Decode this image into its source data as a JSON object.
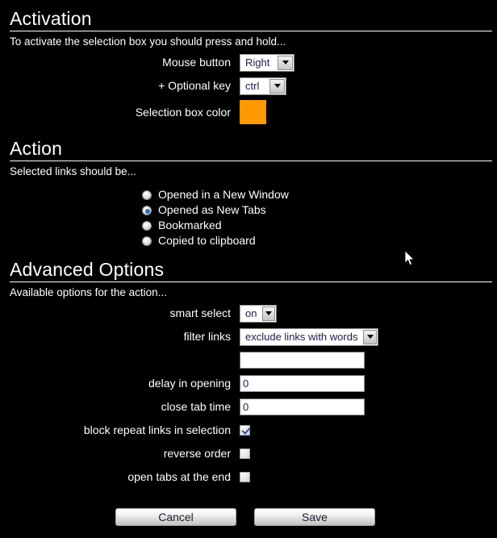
{
  "sections": {
    "activation": {
      "title": "Activation",
      "subtitle": "To activate the selection box you should press and hold...",
      "fields": {
        "mouse_button": {
          "label": "Mouse button",
          "value": "Right"
        },
        "optional_key": {
          "label": "+ Optional key",
          "value": "ctrl"
        },
        "selection_color": {
          "label": "Selection box color",
          "value": "#FF9900"
        }
      }
    },
    "action": {
      "title": "Action",
      "subtitle": "Selected links should be...",
      "options": [
        {
          "label": "Opened in a New Window",
          "selected": false
        },
        {
          "label": "Opened as New Tabs",
          "selected": true
        },
        {
          "label": "Bookmarked",
          "selected": false
        },
        {
          "label": "Copied to clipboard",
          "selected": false
        }
      ]
    },
    "advanced": {
      "title": "Advanced Options",
      "subtitle": "Available options for the action...",
      "fields": {
        "smart_select": {
          "label": "smart select",
          "value": "on"
        },
        "filter_links": {
          "label": "filter links",
          "value": "exclude links with words"
        },
        "filter_words": {
          "label": "",
          "value": "",
          "placeholder": ""
        },
        "delay_in_opening": {
          "label": "delay in opening",
          "value": "0"
        },
        "close_tab_time": {
          "label": "close tab time",
          "value": "0"
        },
        "block_repeat_links": {
          "label": "block repeat links in selection",
          "checked": true
        },
        "reverse_order": {
          "label": "reverse order",
          "checked": false
        },
        "open_tabs_at_end": {
          "label": "open tabs at the end",
          "checked": false
        }
      }
    }
  },
  "footer": {
    "cancel_label": "Cancel",
    "save_label": "Save"
  },
  "colors": {
    "background": "#000000",
    "text": "#FFFFFF",
    "swatch": "#FF9900",
    "radio_accent": "#2B6FC4"
  }
}
